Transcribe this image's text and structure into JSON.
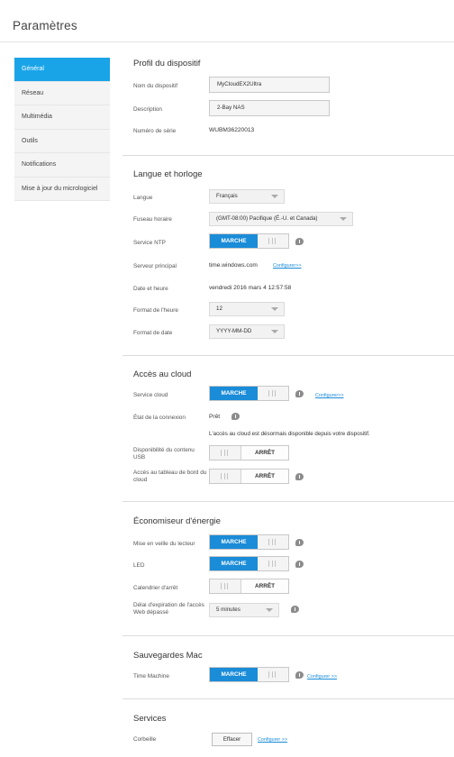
{
  "page": {
    "title": "Paramètres"
  },
  "sidebar": {
    "items": [
      {
        "label": "Général",
        "active": true
      },
      {
        "label": "Réseau"
      },
      {
        "label": "Multimédia"
      },
      {
        "label": "Outils"
      },
      {
        "label": "Notifications"
      },
      {
        "label": "Mise à jour du micrologiciel"
      }
    ]
  },
  "profile": {
    "title": "Profil du dispositif",
    "device_name_label": "Nom du dispositif",
    "device_name_value": "MyCloudEX2Ultra",
    "description_label": "Description",
    "description_value": "2-Bay NAS",
    "serial_label": "Numéro de série",
    "serial_value": "WUBM36220013"
  },
  "language_clock": {
    "title": "Langue et horloge",
    "language_label": "Langue",
    "language_value": "Français",
    "timezone_label": "Fuseau horaire",
    "timezone_value": "(GMT-08:00) Pacifique (É.-U. et Canada)",
    "ntp_label": "Service NTP",
    "ntp_state": "MARCHE",
    "server_label": "Serveur principal",
    "server_value": "time.windows.com",
    "server_link": "Configurer>>",
    "datetime_label": "Date et heure",
    "datetime_value": "vendredi 2016 mars 4 12:57:58",
    "hour_format_label": "Format de l'heure",
    "hour_format_value": "12",
    "date_format_label": "Format de date",
    "date_format_value": "YYYY-MM-DD"
  },
  "cloud": {
    "title": "Accès au cloud",
    "service_label": "Service cloud",
    "service_state": "MARCHE",
    "service_link": "Configurer>>",
    "connection_label": "État de la connexion",
    "connection_value": "Prêt",
    "connection_note": "L'accès au cloud est désormais disponible depuis votre dispositif.",
    "usb_label": "Disponibilité du contenu USB",
    "usb_state": "ARRÊT",
    "dashboard_label": "Accès au tableau de bord du cloud",
    "dashboard_state": "ARRÊT"
  },
  "energy": {
    "title": "Économiseur d'énergie",
    "standby_label": "Mise en veille du lecteur",
    "standby_state": "MARCHE",
    "led_label": "LED",
    "led_state": "MARCHE",
    "schedule_label": "Calendrier d'arrêt",
    "schedule_state": "ARRÊT",
    "timeout_label": "Délai d'expiration de l'accès Web dépassé",
    "timeout_value": "5 minutes"
  },
  "mac": {
    "title": "Sauvegardes Mac",
    "tm_label": "Time Machine",
    "tm_state": "MARCHE",
    "tm_link": "Configurer >>"
  },
  "services": {
    "title": "Services",
    "bin_label": "Corbeille",
    "bin_button": "Effacer",
    "bin_link": "Configurer >>"
  },
  "icons": {
    "info": "info-bubble-icon",
    "chevron": "chevron-down-icon"
  },
  "colors": {
    "accent": "#1a8cd8",
    "sidebar_active": "#1aa4e8"
  }
}
